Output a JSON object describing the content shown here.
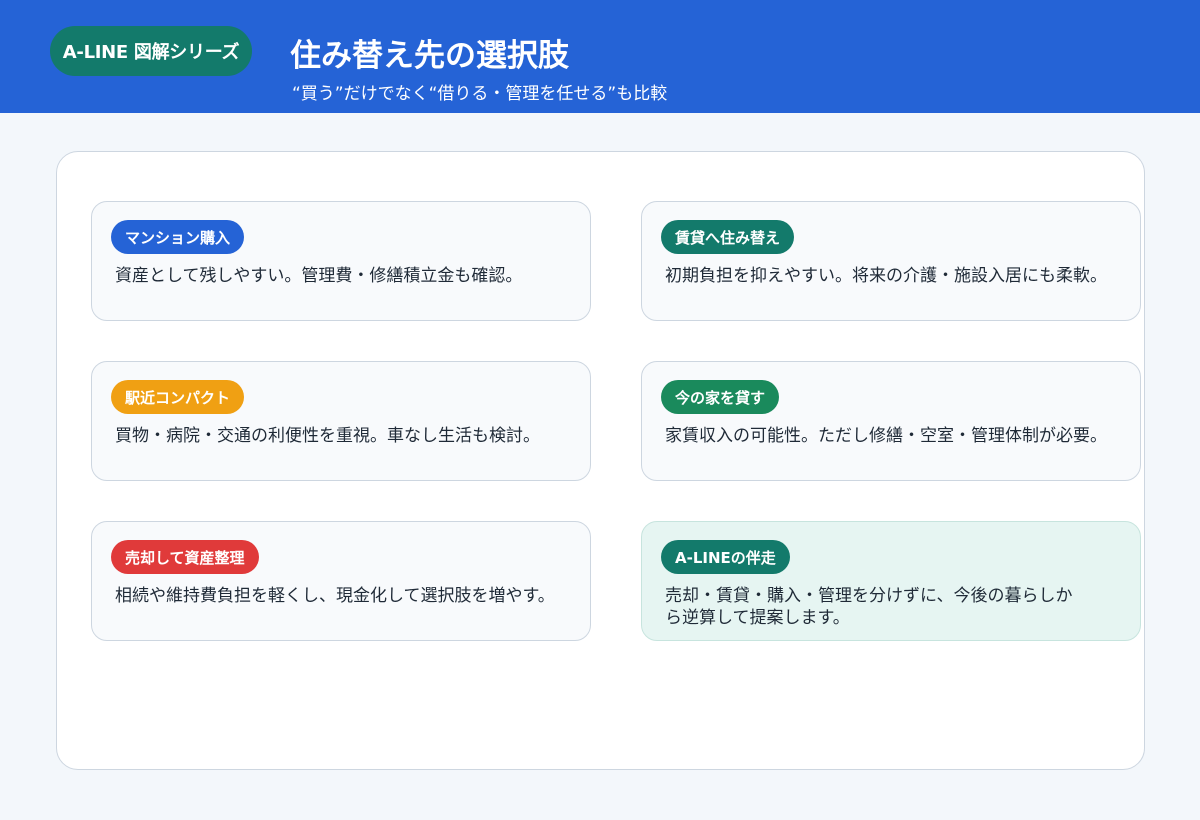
{
  "header": {
    "series_badge": "A-LINE 図解シリーズ",
    "title": "住み替え先の選択肢",
    "subtitle": "“買う”だけでなく“借りる・管理を任せる”も比較"
  },
  "colors": {
    "header_bg": "#2563d6",
    "badge_bg": "#137a6b",
    "tag_blue": "#2563d6",
    "tag_teal": "#137a6b",
    "tag_orange": "#f0a013",
    "tag_green": "#1a8a5c",
    "tag_red": "#e03a3a",
    "highlight_bg": "#e6f5f2"
  },
  "cards": [
    {
      "label": "マンション購入",
      "text": "資産として残しやすい。管理費・修繕積立金も確認。"
    },
    {
      "label": "賃貸へ住み替え",
      "text": "初期負担を抑えやすい。将来の介護・施設入居にも柔軟。"
    },
    {
      "label": "駅近コンパクト",
      "text": "買物・病院・交通の利便性を重視。車なし生活も検討。"
    },
    {
      "label": "今の家を貸す",
      "text": "家賃収入の可能性。ただし修繕・空室・管理体制が必要。"
    },
    {
      "label": "売却して資産整理",
      "text": "相続や維持費負担を軽くし、現金化して選択肢を増やす。"
    },
    {
      "label": "A-LINEの伴走",
      "text": "売却・賃貸・購入・管理を分けずに、今後の暮らしから逆算して提案します。"
    }
  ]
}
